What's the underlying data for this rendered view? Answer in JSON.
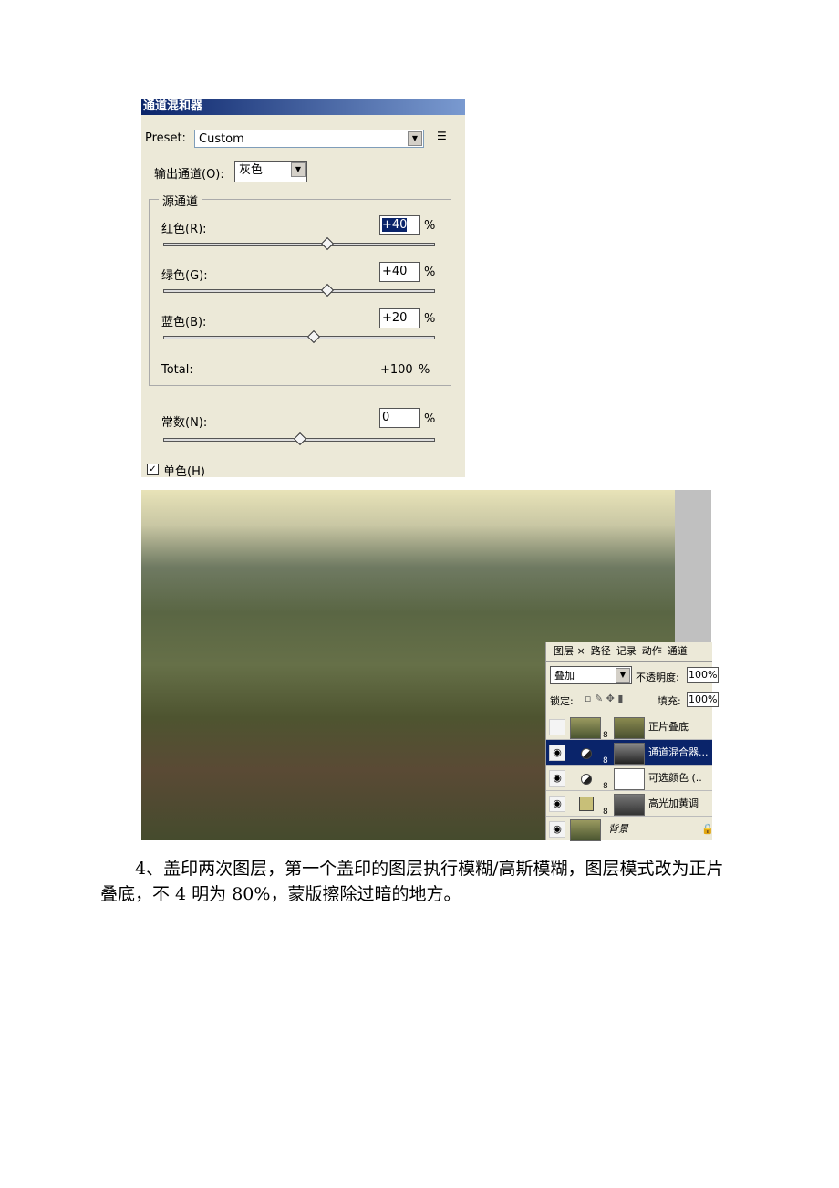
{
  "dialog": {
    "title": "通道混和器",
    "preset_label": "Preset:",
    "preset_value": "Custom",
    "output_label": "输出通道(O):",
    "output_value": "灰色",
    "source_group": "源通道",
    "channels": [
      {
        "label": "红色(R):",
        "value": "+40",
        "percent": 40
      },
      {
        "label": "绿色(G):",
        "value": "+40",
        "percent": 40
      },
      {
        "label": "蓝色(B):",
        "value": "+20",
        "percent": 20
      }
    ],
    "pct": "%",
    "total_label": "Total:",
    "total_value": "+100",
    "constant_label": "常数(N):",
    "constant_value": "0",
    "constant_percent": 0,
    "mono_label": "单色(H)",
    "mono_checked": true
  },
  "layers_panel": {
    "tabs": [
      "图层 ×",
      "路径",
      "记录",
      "动作",
      "通道"
    ],
    "blend_mode": "叠加",
    "opacity_label": "不透明度:",
    "opacity": "100%",
    "lock_label": "锁定:",
    "fill_label": "填充:",
    "fill": "100%",
    "layers": [
      {
        "name": "正片叠底",
        "visible": false
      },
      {
        "name": "通道混合器...",
        "visible": true,
        "active": true
      },
      {
        "name": "可选颜色 (..",
        "visible": true
      },
      {
        "name": "高光加黄调",
        "visible": true
      },
      {
        "name": "背景",
        "visible": true,
        "locked": true
      }
    ]
  },
  "body_text": "4、盖印两次图层，第一个盖印的图层执行模糊/高斯模糊，图层模式改为正片叠底，不 4 明为 80%，蒙版擦除过暗的地方。"
}
